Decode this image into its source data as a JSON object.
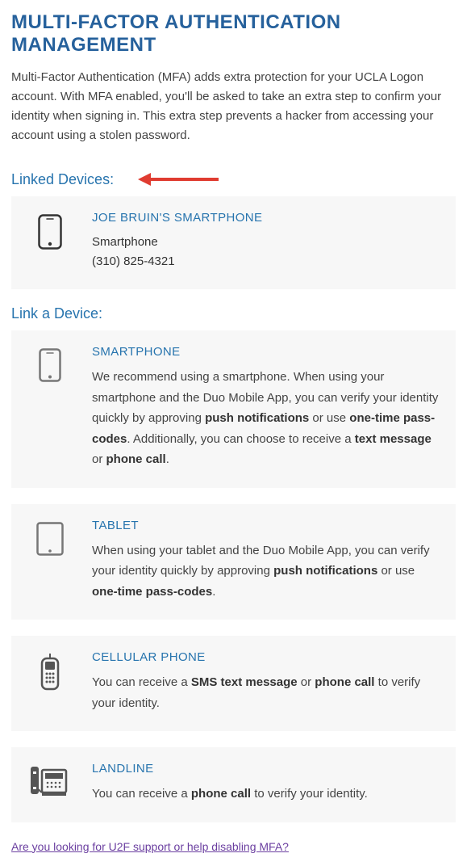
{
  "page": {
    "title": "MULTI-FACTOR AUTHENTICATION MANAGEMENT",
    "intro": "Multi-Factor Authentication (MFA) adds extra protection for your UCLA Logon account. With MFA enabled, you'll be asked to take an extra step to confirm your identity when signing in. This extra step prevents a hacker from accessing your account using a stolen password."
  },
  "linked": {
    "header": "Linked Devices:",
    "devices": [
      {
        "title": "JOE BRUIN'S SMARTPHONE",
        "type": "Smartphone",
        "number": "(310) 825-4321"
      }
    ]
  },
  "link_a_device": {
    "header": "Link a Device:",
    "options": [
      {
        "title": "SMARTPHONE",
        "desc": "We recommend using a smartphone. When using your smartphone and the Duo Mobile App, you can verify your identity quickly by approving <b>push notifications</b> or use <b>one-time pass-codes</b>. Additionally, you can choose to receive a <b>text message</b> or <b>phone call</b>."
      },
      {
        "title": "TABLET",
        "desc": "When using your tablet and the Duo Mobile App, you can verify your identity quickly by approving <b>push notifications</b> or use <b>one-time pass-codes</b>."
      },
      {
        "title": "CELLULAR PHONE",
        "desc": "You can receive a <b>SMS text message</b> or <b>phone call</b> to verify your identity."
      },
      {
        "title": "LANDLINE",
        "desc": "You can receive a <b>phone call</b> to verify your identity."
      }
    ]
  },
  "footer_link": "Are you looking for U2F support or help disabling MFA?"
}
